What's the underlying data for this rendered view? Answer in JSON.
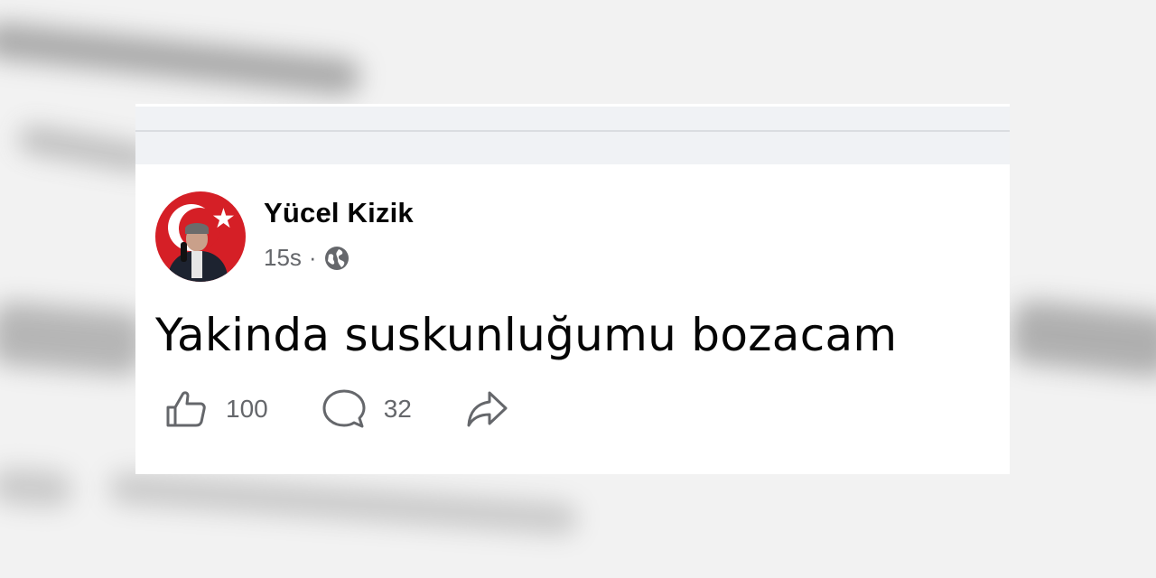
{
  "post": {
    "author_name": "Yücel Kizik",
    "time_ago": "15s",
    "separator": "·",
    "visibility_icon": "globe-icon",
    "text": "Yakinda suskunluğumu bozacam",
    "likes": "100",
    "comments": "32"
  },
  "icons": {
    "like": "thumbs-up-icon",
    "comment": "comment-icon",
    "share": "share-icon"
  },
  "colors": {
    "text_primary": "#050505",
    "text_secondary": "#65676b",
    "flag_red": "#d51f26"
  }
}
